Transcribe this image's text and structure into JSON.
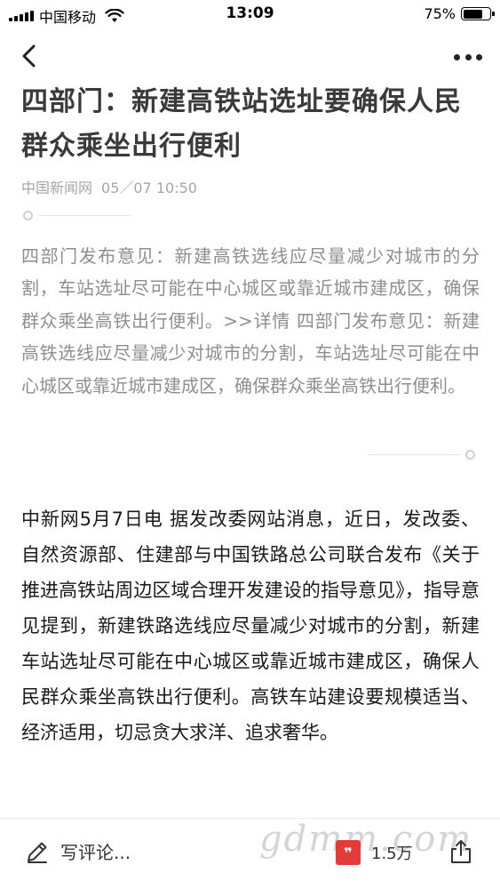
{
  "status_bar": {
    "carrier": "中国移动",
    "time": "13:09",
    "battery_percent": "75%",
    "battery_level": 0.75
  },
  "nav": {
    "back_icon": "chevron-left-icon",
    "more_icon": "more-horizontal-icon"
  },
  "article": {
    "title": "四部门：新建高铁站选址要确保人民群众乘坐出行便利",
    "source": "中国新闻网",
    "date": "05／07 10:50",
    "summary": "四部门发布意见：新建高铁选线应尽量减少对城市的分割，车站选址尽可能在中心城区或靠近城市建成区，确保群众乘坐高铁出行便利。>>详情 四部门发布意见：新建高铁选线应尽量减少对城市的分割，车站选址尽可能在中心城区或靠近城市建成区，确保群众乘坐高铁出行便利。",
    "body": "中新网5月7日电 据发改委网站消息，近日，发改委、自然资源部、住建部与中国铁路总公司联合发布《关于推进高铁站周边区域合理开发建设的指导意见》，指导意见提到，新建铁路选线应尽量减少对城市的分割，新建车站选址尽可能在中心城区或靠近城市建成区，确保人民群众乘坐高铁出行便利。高铁车站建设要规模适当、经济适用，切忌贪大求洋、追求奢华。"
  },
  "bottom_bar": {
    "comment_placeholder": "写评论...",
    "like_count": "1.5万",
    "watermark": "gdmm.com",
    "like_icon": "like-icon",
    "share_icon": "share-icon",
    "comment_icon": "pencil-icon"
  }
}
